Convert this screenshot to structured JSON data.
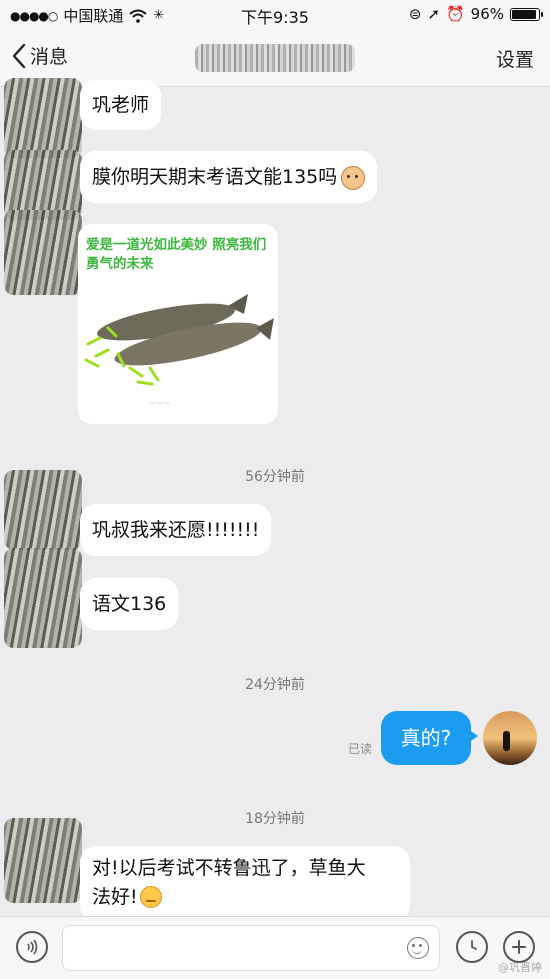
{
  "status_bar": {
    "carrier": "中国联通",
    "time": "下午9:35",
    "battery": "96%",
    "battery_level": 0.96
  },
  "nav": {
    "back_label": "消息",
    "settings_label": "设置"
  },
  "messages": [
    {
      "text": "巩老师"
    },
    {
      "text": "膜你明天期末考语文能135吗"
    },
    {
      "sticker_caption": "爱是一道光如此美妙 照亮我们勇气的未来"
    },
    {
      "time": "56分钟前"
    },
    {
      "text": "巩叔我来还愿!!!!!!!"
    },
    {
      "text": "语文136"
    },
    {
      "time": "24分钟前"
    },
    {
      "text": "真的?",
      "read_label": "已读"
    },
    {
      "time": "18分钟前"
    },
    {
      "text_line1": "对!以后考试不转鲁迅了，草鱼大",
      "text_line2": "法好!"
    }
  ],
  "footer": {
    "watermark": "@巩晋婷"
  },
  "icons": [
    "back-icon",
    "wifi-icon",
    "location-icon",
    "alarm-icon",
    "battery-icon",
    "voice-icon",
    "smile-icon",
    "clock-icon",
    "plus-icon"
  ],
  "colors": {
    "accent": "#1c9cf1",
    "background": "#ececef",
    "bubble": "#ffffff"
  }
}
